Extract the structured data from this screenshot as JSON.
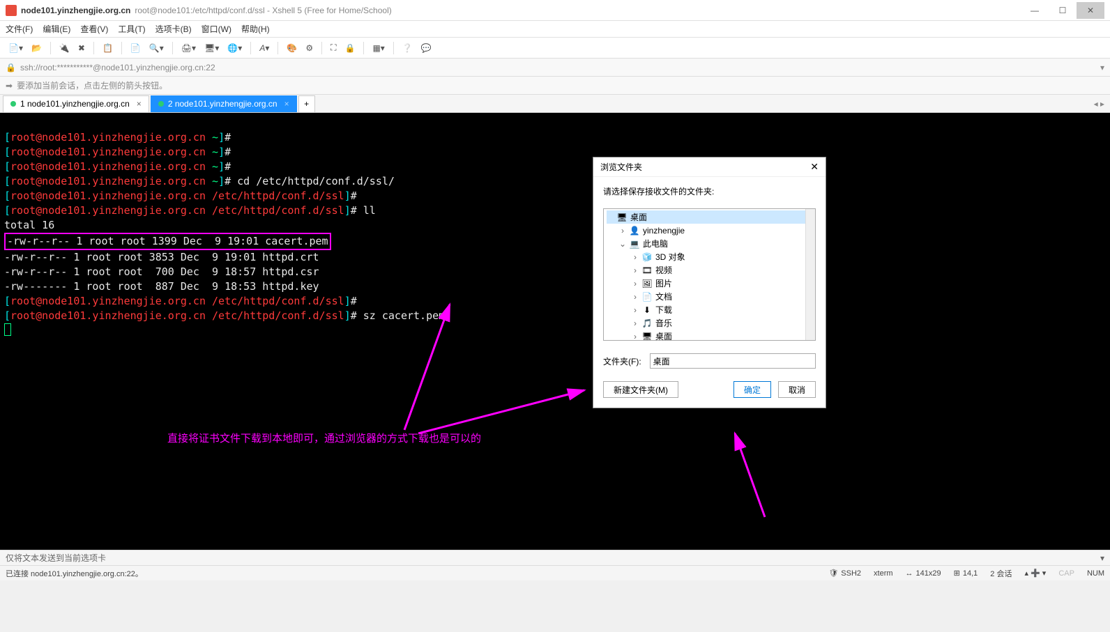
{
  "window": {
    "host": "node101.yinzhengjie.org.cn",
    "title_suffix": "root@node101:/etc/httpd/conf.d/ssl - Xshell 5 (Free for Home/School)"
  },
  "menubar": [
    "文件(F)",
    "编辑(E)",
    "查看(V)",
    "工具(T)",
    "选项卡(B)",
    "窗口(W)",
    "帮助(H)"
  ],
  "address": "ssh://root:***********@node101.yinzhengjie.org.cn:22",
  "hint": "要添加当前会话，点击左侧的箭头按钮。",
  "tabs": [
    {
      "label": "1 node101.yinzhengjie.org.cn",
      "active": false
    },
    {
      "label": "2 node101.yinzhengjie.org.cn",
      "active": true
    }
  ],
  "prompt": {
    "user_host": "root@node101.yinzhengjie.org.cn",
    "tilde": "~",
    "sslpath": "/etc/httpd/conf.d/ssl",
    "cmd_cd": "cd /etc/httpd/conf.d/ssl/",
    "cmd_ll": "ll",
    "total": "total 16",
    "ls1": "-rw-r--r-- 1 root root 1399 Dec  9 19:01 cacert.pem",
    "ls2": "-rw-r--r-- 1 root root 3853 Dec  9 19:01 httpd.crt",
    "ls3": "-rw-r--r-- 1 root root  700 Dec  9 18:57 httpd.csr",
    "ls4": "-rw------- 1 root root  887 Dec  9 18:53 httpd.key",
    "cmd_sz": "sz cacert.pem"
  },
  "annotation": "直接将证书文件下载到本地即可，通过浏览器的方式下载也是可以的",
  "dialog": {
    "title": "浏览文件夹",
    "message": "请选择保存接收文件的文件夹:",
    "tree": [
      {
        "indent": 0,
        "exp": "",
        "icon": "🖥",
        "label": "桌面",
        "sel": true
      },
      {
        "indent": 1,
        "exp": "›",
        "icon": "👤",
        "label": "yinzhengjie"
      },
      {
        "indent": 1,
        "exp": "⌄",
        "icon": "💻",
        "label": "此电脑"
      },
      {
        "indent": 2,
        "exp": "›",
        "icon": "🧊",
        "label": "3D 对象"
      },
      {
        "indent": 2,
        "exp": "›",
        "icon": "🎞",
        "label": "视频"
      },
      {
        "indent": 2,
        "exp": "›",
        "icon": "🖼",
        "label": "图片"
      },
      {
        "indent": 2,
        "exp": "›",
        "icon": "📄",
        "label": "文档"
      },
      {
        "indent": 2,
        "exp": "›",
        "icon": "⬇",
        "label": "下载"
      },
      {
        "indent": 2,
        "exp": "›",
        "icon": "🎵",
        "label": "音乐"
      },
      {
        "indent": 2,
        "exp": "›",
        "icon": "🖥",
        "label": "桌面"
      }
    ],
    "folder_label": "文件夹(F):",
    "folder_value": "桌面",
    "btn_new": "新建文件夹(M)",
    "btn_ok": "确定",
    "btn_cancel": "取消"
  },
  "bottom_hint": "仅将文本发送到当前选项卡",
  "status": {
    "conn": "已连接 node101.yinzhengjie.org.cn:22。",
    "ssh": "SSH2",
    "term": "xterm",
    "size": "141x29",
    "pos": "14,1",
    "sessions": "2 会话",
    "cap": "CAP",
    "num": "NUM"
  }
}
